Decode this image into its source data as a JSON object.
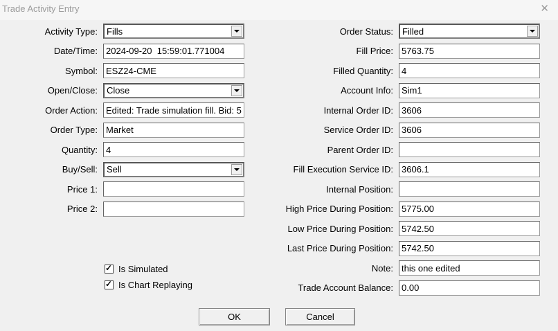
{
  "window": {
    "title": "Trade Activity Entry"
  },
  "icons": {
    "close": "✕",
    "check": "✓"
  },
  "colors": {
    "dialog_bg": "#f0f0f0",
    "titlebar_bg": "#f6f6f6",
    "title_text": "#9b9b9b",
    "field_bg": "#ffffff",
    "field_border": "#636363"
  },
  "left_fields": [
    {
      "label": "Activity Type:",
      "value": "Fills",
      "type": "combobox"
    },
    {
      "label": "Date/Time:",
      "value": "2024-09-20  15:59:01.771004",
      "type": "text"
    },
    {
      "label": "Symbol:",
      "value": "ESZ24-CME",
      "type": "text"
    },
    {
      "label": "Open/Close:",
      "value": "Close",
      "type": "combobox"
    },
    {
      "label": "Order Action:",
      "value": "Edited: Trade simulation fill. Bid: 5",
      "type": "text"
    },
    {
      "label": "Order Type:",
      "value": "Market",
      "type": "text"
    },
    {
      "label": "Quantity:",
      "value": "4",
      "type": "text"
    },
    {
      "label": "Buy/Sell:",
      "value": "Sell",
      "type": "combobox"
    },
    {
      "label": "Price 1:",
      "value": "",
      "type": "text"
    },
    {
      "label": "Price 2:",
      "value": "",
      "type": "text"
    }
  ],
  "right_fields": [
    {
      "label": "Order Status:",
      "value": "Filled",
      "type": "combobox"
    },
    {
      "label": "Fill Price:",
      "value": "5763.75",
      "type": "text"
    },
    {
      "label": "Filled Quantity:",
      "value": "4",
      "type": "text"
    },
    {
      "label": "Account Info:",
      "value": "Sim1",
      "type": "text"
    },
    {
      "label": "Internal Order ID:",
      "value": "3606",
      "type": "text"
    },
    {
      "label": "Service Order ID:",
      "value": "3606",
      "type": "text"
    },
    {
      "label": "Parent Order ID:",
      "value": "",
      "type": "text"
    },
    {
      "label": "Fill Execution Service ID:",
      "value": "3606.1",
      "type": "text"
    },
    {
      "label": "Internal Position:",
      "value": "",
      "type": "text"
    },
    {
      "label": "High Price During Position:",
      "value": "5775.00",
      "type": "text"
    },
    {
      "label": "Low Price During Position:",
      "value": "5742.50",
      "type": "text"
    },
    {
      "label": "Last Price During Position:",
      "value": "5742.50",
      "type": "text"
    },
    {
      "label": "Note:",
      "value": "this one edited",
      "type": "text"
    },
    {
      "label": "Trade Account Balance:",
      "value": "0.00",
      "type": "text"
    }
  ],
  "checkboxes": [
    {
      "label": "Is Simulated",
      "checked": true
    },
    {
      "label": "Is Chart Replaying",
      "checked": true
    }
  ],
  "buttons": {
    "ok": "OK",
    "cancel": "Cancel"
  }
}
